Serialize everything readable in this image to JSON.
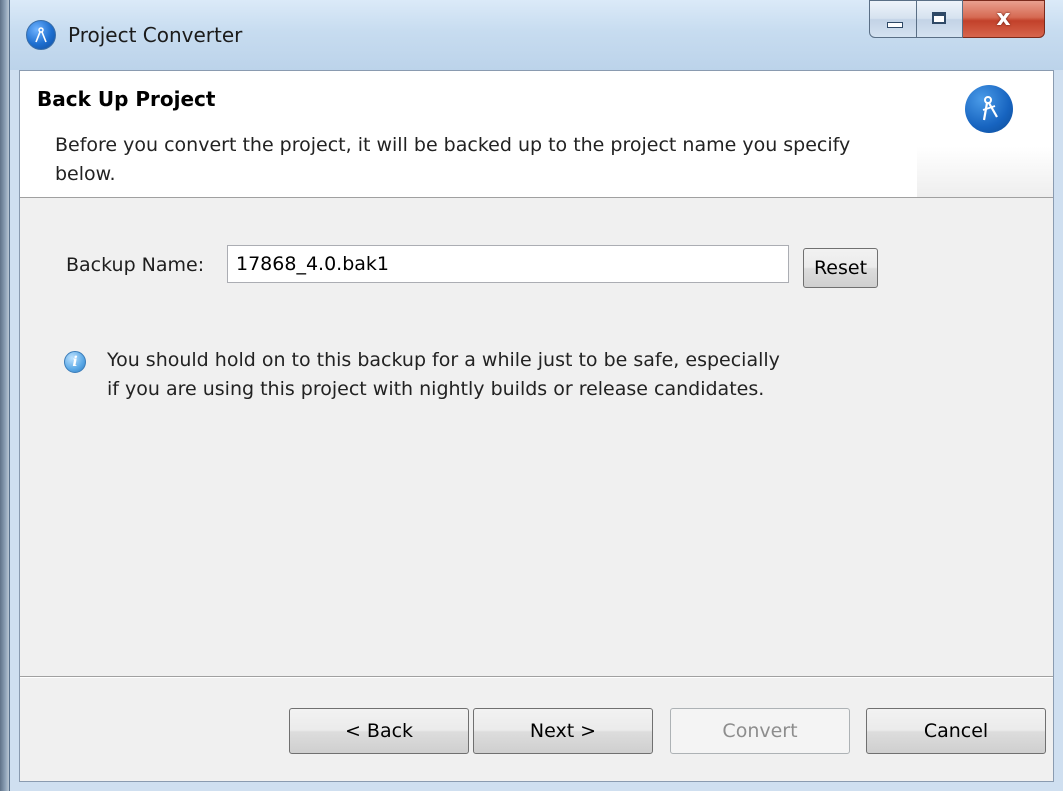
{
  "window": {
    "title": "Project Converter",
    "close_glyph": "x"
  },
  "header": {
    "title": "Back Up Project",
    "description": "Before you convert the project, it will be backed up to the project name you specify below."
  },
  "form": {
    "backup_label": "Backup Name:",
    "backup_value": "17868_4.0.bak1",
    "reset_label": "Reset"
  },
  "info": {
    "icon": "info-icon",
    "text": "You should hold on to this backup for a while just to be safe, especially if you are using this project with nightly builds or release candidates."
  },
  "buttons": {
    "back": "< Back",
    "next": "Next >",
    "convert": "Convert",
    "cancel": "Cancel"
  },
  "colors": {
    "titlebar": "#c7dcf0",
    "close_button": "#c2412a",
    "accent_icon": "#1764c0"
  }
}
